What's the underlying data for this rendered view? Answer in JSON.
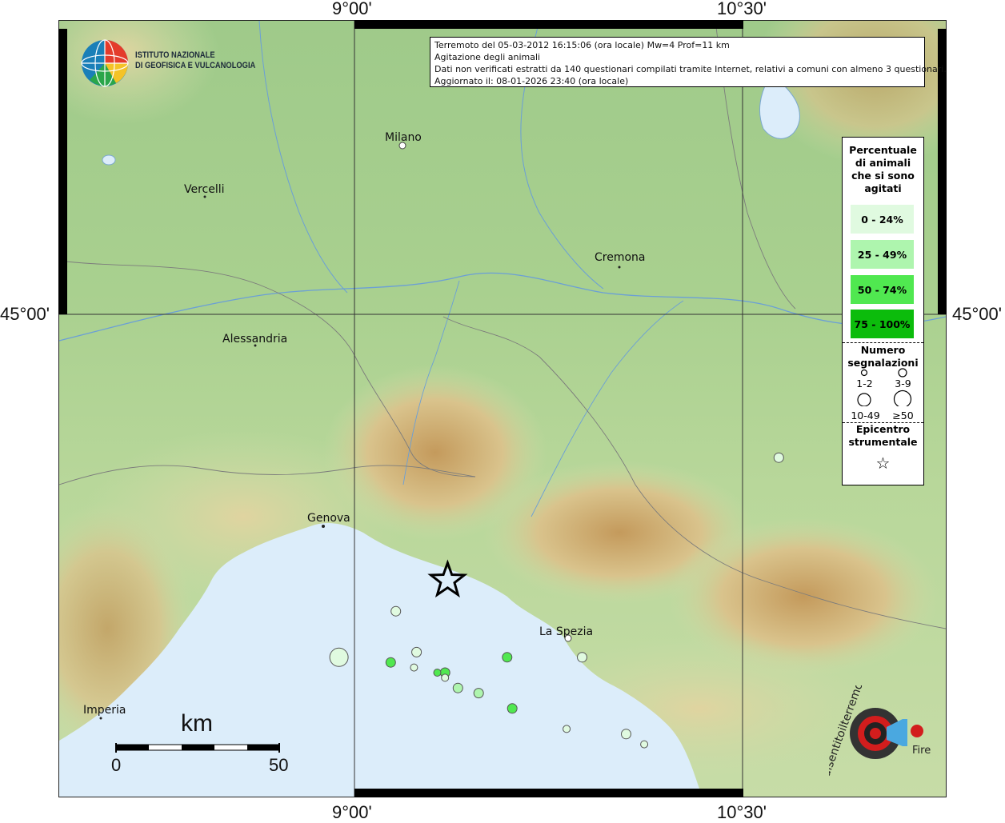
{
  "coordinates": {
    "top_left": "9°00'",
    "top_right": "10°30'",
    "bottom_left": "9°00'",
    "bottom_right": "10°30'",
    "left": "45°00'",
    "right": "45°00'"
  },
  "info": {
    "line1": "Terremoto del 05-03-2012 16:15:06 (ora locale) Mw=4 Prof=11 km",
    "line2": "Agitazione degli animali",
    "line3": "Dati non verificati estratti da 140 questionari compilati tramite Internet, relativi a comuni con almeno 3 questionari.",
    "line4": "Aggiornato il: 08-01-2026 23:40 (ora locale)"
  },
  "institute": {
    "line1": "ISTITUTO NAZIONALE",
    "line2": "DI GEOFISICA E VULCANOLOGIA"
  },
  "cities": [
    {
      "name": "Milano"
    },
    {
      "name": "Vercelli"
    },
    {
      "name": "Cremona"
    },
    {
      "name": "Alessandria"
    },
    {
      "name": "Genova"
    },
    {
      "name": "La Spezia"
    },
    {
      "name": "Imperia"
    }
  ],
  "legend": {
    "title_line1": "Percentuale",
    "title_line2": "di animali",
    "title_line3": "che si sono",
    "title_line4": "agitati",
    "classes": [
      {
        "label": "0 - 24%",
        "color": "#e0fae0"
      },
      {
        "label": "25 - 49%",
        "color": "#aef5ae"
      },
      {
        "label": "50 - 74%",
        "color": "#50e850"
      },
      {
        "label": "75 - 100%",
        "color": "#0cbc0c"
      }
    ],
    "count_title_line1": "Numero",
    "count_title_line2": "segnalazioni",
    "size_labels": [
      "1-2",
      "3-9",
      "10-49",
      "≥50"
    ],
    "epicenter_line1": "Epicentro",
    "epicenter_line2": "strumentale",
    "star_symbol": "☆"
  },
  "scale": {
    "title": "km",
    "min": "0",
    "max": "50"
  },
  "points": [
    {
      "x_deg": 10.64,
      "lat_deg": 44.72,
      "class": 0,
      "size": 1
    },
    {
      "x_deg": 9.16,
      "lat_deg": 44.42,
      "class": 0,
      "size": 1
    },
    {
      "x_deg": 8.94,
      "lat_deg": 44.33,
      "class": 0,
      "size": 3
    },
    {
      "x_deg": 9.24,
      "lat_deg": 44.34,
      "class": 0,
      "size": 1
    },
    {
      "x_deg": 9.23,
      "lat_deg": 44.31,
      "class": 0,
      "size": 0
    },
    {
      "x_deg": 9.14,
      "lat_deg": 44.32,
      "class": 2,
      "size": 1
    },
    {
      "x_deg": 9.35,
      "lat_deg": 44.3,
      "class": 2,
      "size": 1
    },
    {
      "x_deg": 9.32,
      "lat_deg": 44.3,
      "class": 2,
      "size": 0
    },
    {
      "x_deg": 9.35,
      "lat_deg": 44.29,
      "class": 0,
      "size": 0
    },
    {
      "x_deg": 9.4,
      "lat_deg": 44.27,
      "class": 1,
      "size": 1
    },
    {
      "x_deg": 9.48,
      "lat_deg": 44.26,
      "class": 1,
      "size": 1
    },
    {
      "x_deg": 9.61,
      "lat_deg": 44.23,
      "class": 2,
      "size": 1
    },
    {
      "x_deg": 9.59,
      "lat_deg": 44.33,
      "class": 2,
      "size": 1
    },
    {
      "x_deg": 9.88,
      "lat_deg": 44.33,
      "class": 0,
      "size": 1
    },
    {
      "x_deg": 10.05,
      "lat_deg": 44.18,
      "class": 0,
      "size": 1
    },
    {
      "x_deg": 10.12,
      "lat_deg": 44.16,
      "class": 0,
      "size": 0
    },
    {
      "x_deg": 9.82,
      "lat_deg": 44.19,
      "class": 0,
      "size": 0
    }
  ],
  "epicenter": {
    "lon_deg": 9.36,
    "lat_deg": 44.48
  },
  "hsit": {
    "text": "haisentitoilterremoto.it",
    "url": "www",
    "fire": "Fire"
  }
}
